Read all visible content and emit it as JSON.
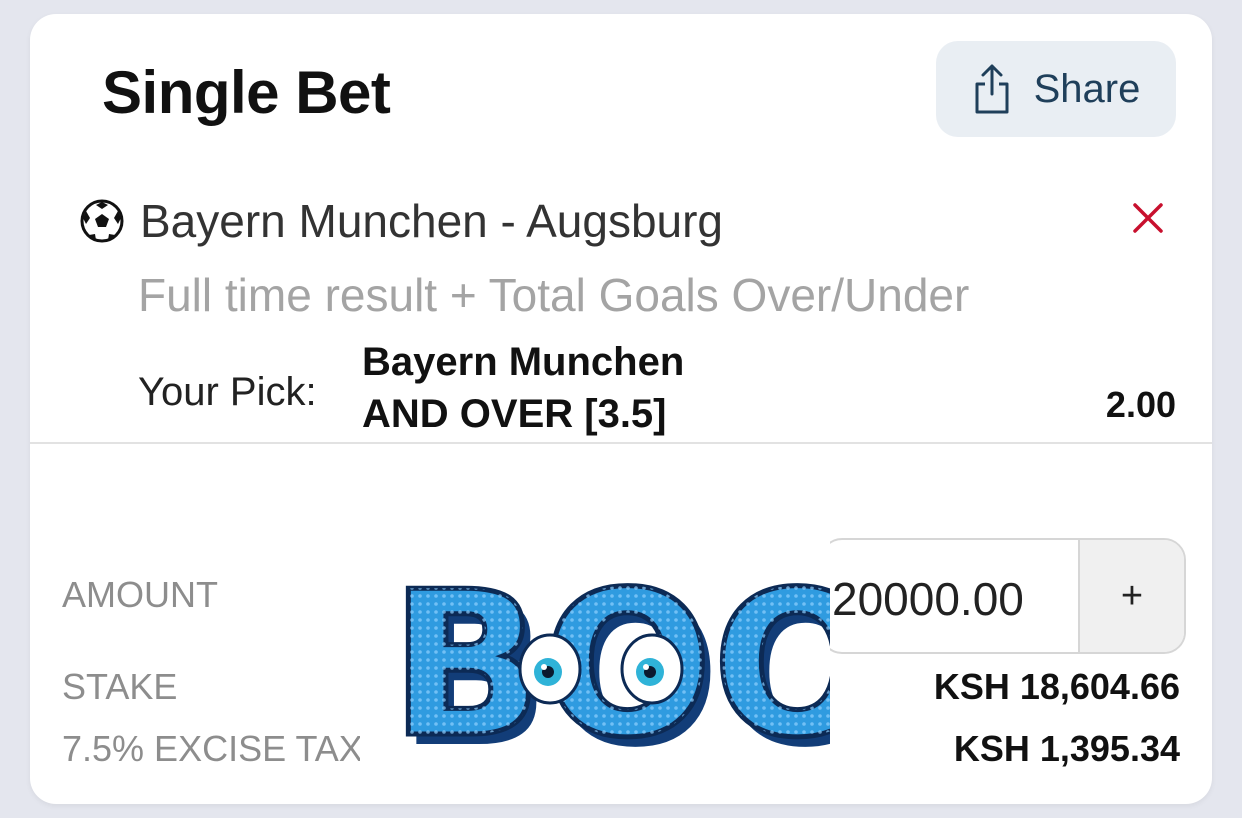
{
  "header": {
    "title": "Single Bet",
    "share_label": "Share"
  },
  "selection": {
    "match": "Bayern Munchen - Augsburg",
    "market": "Full time result + Total Goals Over/Under",
    "pick_label": "Your Pick:",
    "pick_line1": "Bayern Munchen",
    "pick_line2": "AND OVER [3.5]",
    "odds": "2.00"
  },
  "totals": {
    "amount_label": "AMOUNT",
    "amount_value": "20000.00",
    "plus_label": "+",
    "stake_label": "STAKE",
    "stake_value": "KSH 18,604.66",
    "tax_label": "7.5% EXCISE TAX",
    "tax_value": "KSH 1,395.34"
  },
  "sticker": {
    "text": "BOOM"
  },
  "colors": {
    "share_bg": "#e9eef3",
    "share_text": "#1f3f5a",
    "remove": "#c8102e",
    "boom": "#2f9be0"
  },
  "icons": [
    "share-icon",
    "soccer-ball-icon",
    "close-icon",
    "plus-icon"
  ]
}
